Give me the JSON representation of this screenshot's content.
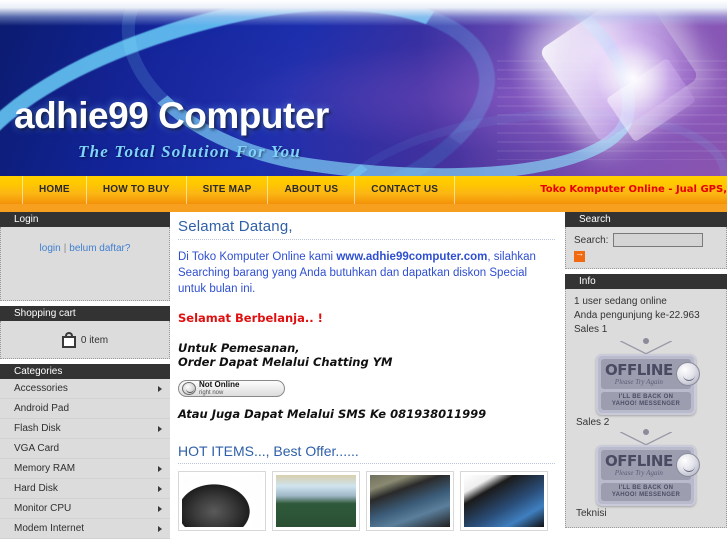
{
  "banner": {
    "logo": "adhie99 Computer",
    "tagline": "The Total Solution For You"
  },
  "nav": {
    "items": [
      {
        "label": "HOME"
      },
      {
        "label": "HOW TO BUY"
      },
      {
        "label": "SITE MAP"
      },
      {
        "label": "ABOUT US"
      },
      {
        "label": "CONTACT US"
      }
    ],
    "marquee": "Toko Komputer Online - Jual GPS,",
    "marquee_color": "#e80000"
  },
  "sidebar_left": {
    "login": {
      "title": "Login",
      "login_link": "login",
      "separator": "|",
      "register_link": "belum daftar?"
    },
    "cart": {
      "title": "Shopping cart",
      "icon": "shopping-bag-icon",
      "count_text": "0 item"
    },
    "categories": {
      "title": "Categories",
      "items": [
        {
          "label": "Accessories",
          "has_sub": true
        },
        {
          "label": "Android Pad",
          "has_sub": false
        },
        {
          "label": "Flash Disk",
          "has_sub": true
        },
        {
          "label": "VGA Card",
          "has_sub": false
        },
        {
          "label": "Memory RAM",
          "has_sub": true
        },
        {
          "label": "Hard Disk",
          "has_sub": true
        },
        {
          "label": "Monitor CPU",
          "has_sub": true
        },
        {
          "label": "Modem Internet",
          "has_sub": true
        }
      ]
    }
  },
  "main": {
    "heading": "Selamat Datang,",
    "welcome_part1": "Di Toko Komputer Online kami ",
    "welcome_site": "www.adhie99computer.com",
    "welcome_part2": ", silahkan Searching barang yang Anda butuhkan dan dapatkan diskon Special untuk bulan ini.",
    "berbelanja": "Selamat Berbelanja.. !",
    "order_line1": "Untuk Pemesanan,",
    "order_line2": "Order Dapat Melalui Chatting YM",
    "ym_status_line1": "Not Online",
    "ym_status_line2": "right now",
    "sms_line": "Atau Juga Dapat Melalui SMS Ke 081938011999",
    "hot_heading": "HOT ITEMS..., Best Offer......",
    "products": [
      {
        "alt": "product-thumbnail-1"
      },
      {
        "alt": "product-thumbnail-2"
      },
      {
        "alt": "product-thumbnail-3"
      },
      {
        "alt": "product-thumbnail-4"
      }
    ]
  },
  "sidebar_right": {
    "search": {
      "title": "Search",
      "label": "Search:",
      "value": "",
      "placeholder": "",
      "go_icon": "arrow-right-icon"
    },
    "info": {
      "title": "Info",
      "online_users": "1 user sedang online",
      "visitor_count": "Anda pengunjung ke-22.963",
      "sales1_label": "Sales 1",
      "sales2_label": "Sales 2",
      "teknisi_label": "Teknisi",
      "ym_sign": {
        "big": "OFFLINE",
        "small": "Please Try Again",
        "bottom_line1": "I'LL BE BACK ON",
        "bottom_line2": "YAHOO! MESSENGER"
      }
    }
  },
  "colors": {
    "nav_gradient_start": "#ffd000",
    "nav_gradient_end": "#f39208",
    "accent_orange": "#f79f1f",
    "panel_header": "#333333",
    "panel_body": "#dcdcdc",
    "link_blue": "#3f7fd0",
    "heading_blue": "#2f5fa8",
    "body_blue": "#2f4fd0",
    "alert_red": "#e01010"
  }
}
